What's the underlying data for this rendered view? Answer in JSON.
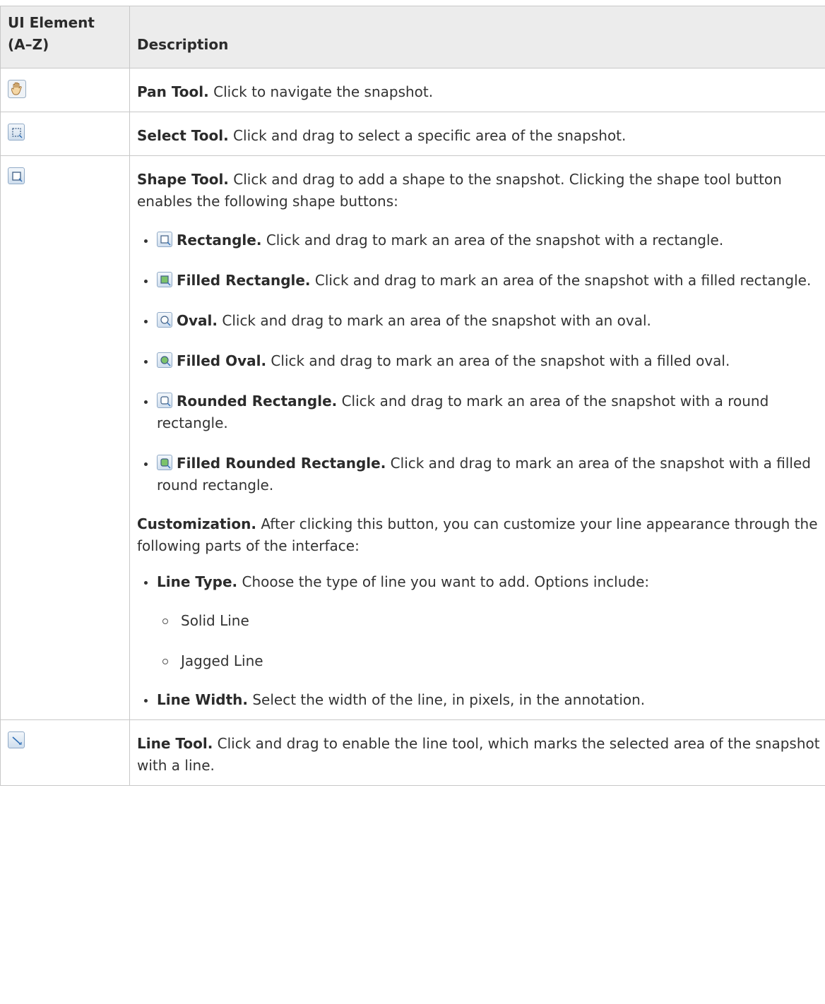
{
  "table": {
    "headers": {
      "col1": "UI Element (A–Z)",
      "col2": "Description"
    },
    "rows": [
      {
        "icon": "hand-icon",
        "name": "Pan Tool.",
        "text": "Click to navigate the snapshot."
      },
      {
        "icon": "select-tool-icon",
        "name": "Select Tool.",
        "text": "Click and drag to select a specific area of the snapshot."
      },
      {
        "icon": "shape-tool-icon",
        "name": "Shape Tool.",
        "text": "Click and drag to add a shape to the snapshot. Clicking the shape tool button enables the following shape buttons:",
        "shapes": [
          {
            "icon": "rectangle-icon",
            "name": "Rectangle.",
            "text": "Click and drag to mark an area of the snapshot with a rectangle."
          },
          {
            "icon": "filled-rectangle-icon",
            "name": "Filled Rectangle.",
            "text": "Click and drag to mark an area of the snapshot with a filled rectangle."
          },
          {
            "icon": "oval-icon",
            "name": "Oval.",
            "text": "Click and drag to mark an area of the snapshot with an oval."
          },
          {
            "icon": "filled-oval-icon",
            "name": "Filled Oval.",
            "text": "Click and drag to mark an area of the snapshot with a filled oval."
          },
          {
            "icon": "rounded-rectangle-icon",
            "name": "Rounded Rectangle.",
            "text": "Click and drag to mark an area of the snapshot with a round rectangle."
          },
          {
            "icon": "filled-rounded-rectangle-icon",
            "name": "Filled Rounded Rectangle.",
            "text": "Click and drag to mark an area of the snapshot with a filled round rectangle."
          }
        ],
        "customization": {
          "name": "Customization.",
          "text": "After clicking this button, you can customize your line appearance through the following parts of the interface:",
          "items": [
            {
              "name": "Line Type.",
              "text": "Choose the type of line you want to add. Options include:",
              "options": [
                "Solid Line",
                "Jagged Line"
              ]
            },
            {
              "name": "Line Width.",
              "text": "Select the width of the line, in pixels, in the annotation."
            }
          ]
        }
      },
      {
        "icon": "line-tool-icon",
        "name": "Line Tool.",
        "text": "Click and drag to enable the line tool, which marks the selected area of the snapshot with a line."
      }
    ]
  },
  "colors": {
    "header_bg": "#ececec",
    "border": "#c8c8c8",
    "icon_border": "#8fa9c6",
    "icon_fill_green": "#7cc36b"
  }
}
